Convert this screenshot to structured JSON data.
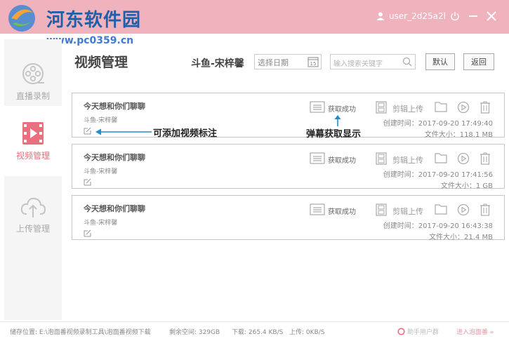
{
  "watermark": {
    "title": "河东软件园",
    "url": "www.pc0359.cn"
  },
  "titlebar": {
    "username": "user_2d25a2l"
  },
  "sidebar": {
    "items": [
      {
        "label": "直播录制",
        "icon": "film-reel-icon",
        "active": false
      },
      {
        "label": "视频管理",
        "icon": "video-file-icon",
        "active": true
      },
      {
        "label": "上传管理",
        "icon": "cloud-upload-icon",
        "active": false
      }
    ]
  },
  "header": {
    "title": "视频管理",
    "channel": "斗鱼-宋梓馨",
    "date_placeholder": "选择日期",
    "search_placeholder": "输入搜索关键字",
    "default_label": "默认",
    "back_label": "返回"
  },
  "cards": [
    {
      "title": "今天想和你们聊聊",
      "channel": "斗鱼-宋梓馨",
      "status": "获取成功",
      "clip": "剪辑上传",
      "created": "创建时间：2017-09-20 17:49:40",
      "size": "文件大小：118.1 MB"
    },
    {
      "title": "今天想和你们聊聊",
      "channel": "斗鱼-宋梓馨",
      "status": "获取成功",
      "clip": "剪辑上传",
      "created": "创建时间：2017-09-20 17:41:56",
      "size": "文件大小：1 GB"
    },
    {
      "title": "今天想和你们聊聊",
      "channel": "斗鱼-宋梓馨",
      "status": "获取成功",
      "clip": "剪辑上传",
      "created": "创建时间：2017-09-20 16:43:38",
      "size": "文件大小：21.4 MB"
    }
  ],
  "annotations": {
    "edit_note": "可添加视频标注",
    "danmaku_note": "弹幕获取显示"
  },
  "statusbar": {
    "path": "储存位置: E:\\泡面番视频录制工具\\泡面番视频下载",
    "free": "剩余空间: 329GB",
    "down": "下载: 265.4 KB/S",
    "up": "上传: 0KB/S",
    "group": "助手用户群",
    "room": "进入泡面番 »"
  },
  "colors": {
    "titlebar": "#f0b2bd",
    "accent": "#e8707f",
    "annotation_arrow": "#1e8fc8"
  }
}
